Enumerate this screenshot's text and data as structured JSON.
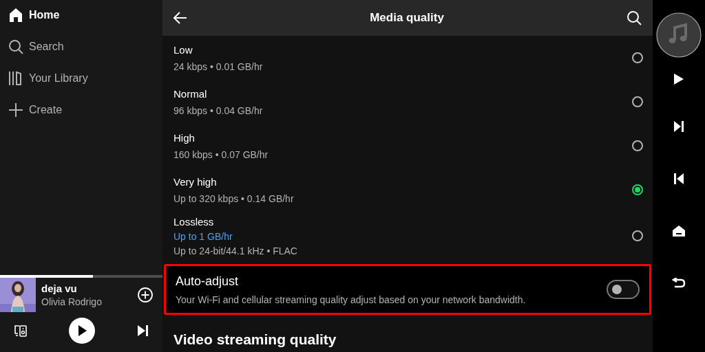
{
  "sidebar": {
    "items": [
      {
        "label": "Home",
        "kind": "home",
        "selected": true
      },
      {
        "label": "Search",
        "kind": "search",
        "selected": false
      },
      {
        "label": "Your Library",
        "kind": "library",
        "selected": false
      },
      {
        "label": "Create",
        "kind": "create",
        "selected": false
      }
    ]
  },
  "now_playing": {
    "title": "deja vu",
    "artist": "Olivia Rodrigo",
    "level": 0.57,
    "playing": false
  },
  "header": {
    "title": "Media quality"
  },
  "options": [
    {
      "title": "Low",
      "lines": [
        "24 kbps • 0.01 GB/hr"
      ],
      "selected": false
    },
    {
      "title": "Normal",
      "lines": [
        "96 kbps • 0.04 GB/hr"
      ],
      "selected": false
    },
    {
      "title": "High",
      "lines": [
        "160 kbps • 0.07 GB/hr"
      ],
      "selected": false
    },
    {
      "title": "Very high",
      "lines": [
        "Up to 320 kbps • 0.14 GB/hr"
      ],
      "selected": true
    },
    {
      "title": "Lossless",
      "link": "Up to 1 GB/hr",
      "lines": [
        "Up to 24-bit/44.1 kHz • FLAC"
      ],
      "selected": false
    }
  ],
  "auto_adjust": {
    "title": "Auto-adjust",
    "description": "Your Wi-Fi and cellular streaming quality adjust based on your network bandwidth.",
    "on": false,
    "highlighted": true
  },
  "section_heading": "Video streaming quality"
}
